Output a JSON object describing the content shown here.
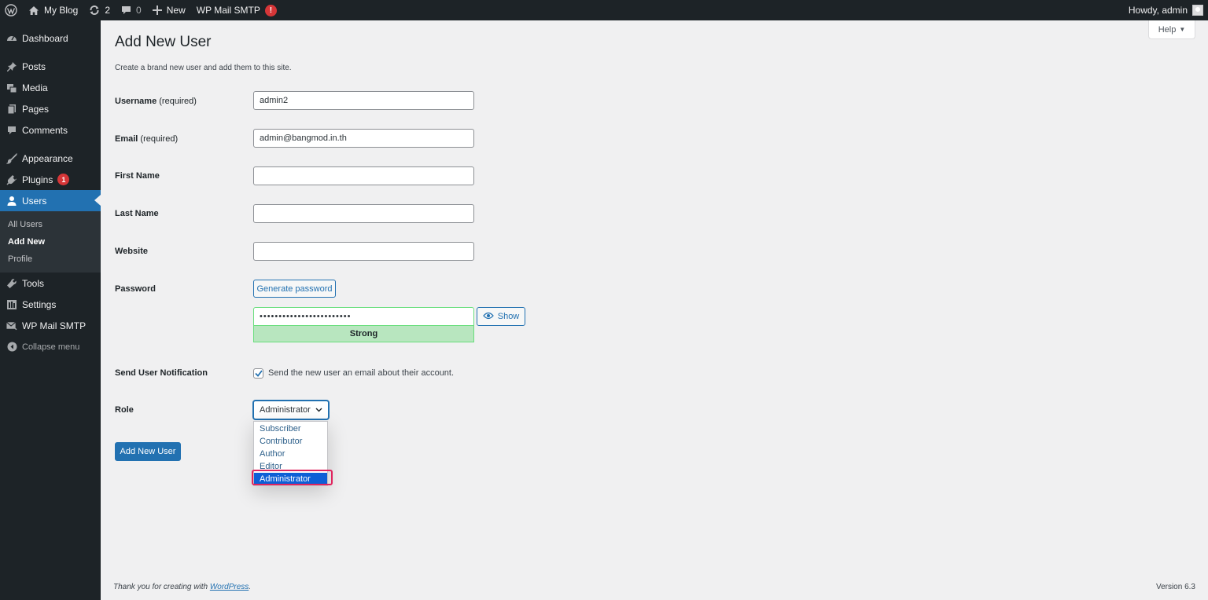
{
  "adminbar": {
    "site_name": "My Blog",
    "updates_count": "2",
    "comments_count": "0",
    "new_label": "New",
    "plugin_label": "WP Mail SMTP",
    "plugin_alert": "!",
    "greeting": "Howdy, admin"
  },
  "sidebar": {
    "items": [
      {
        "label": "Dashboard",
        "icon": "dashboard-icon"
      },
      {
        "label": "Posts",
        "icon": "pin-icon"
      },
      {
        "label": "Media",
        "icon": "media-icon"
      },
      {
        "label": "Pages",
        "icon": "pages-icon"
      },
      {
        "label": "Comments",
        "icon": "comments-icon"
      },
      {
        "label": "Appearance",
        "icon": "brush-icon"
      },
      {
        "label": "Plugins",
        "icon": "plugin-icon",
        "badge": "1"
      },
      {
        "label": "Users",
        "icon": "user-icon"
      },
      {
        "label": "Tools",
        "icon": "wrench-icon"
      },
      {
        "label": "Settings",
        "icon": "settings-icon"
      },
      {
        "label": "WP Mail SMTP",
        "icon": "mail-icon"
      }
    ],
    "submenu": [
      "All Users",
      "Add New",
      "Profile"
    ],
    "collapse": "Collapse menu"
  },
  "main": {
    "help": "Help",
    "title": "Add New User",
    "description": "Create a brand new user and add them to this site.",
    "form": {
      "username_label": "Username",
      "username_req": "(required)",
      "username_value": "admin2",
      "email_label": "Email",
      "email_req": "(required)",
      "email_value": "admin@bangmod.in.th",
      "first_name_label": "First Name",
      "first_name_value": "",
      "last_name_label": "Last Name",
      "last_name_value": "",
      "website_label": "Website",
      "website_value": "",
      "password_label": "Password",
      "generate_password": "Generate password",
      "password_value": "••••••••••••••••••••••••",
      "show_label": "Show",
      "strength": "Strong",
      "notification_label": "Send User Notification",
      "notification_text": "Send the new user an email about their account.",
      "role_label": "Role",
      "role_value": "Administrator",
      "role_options": [
        "Subscriber",
        "Contributor",
        "Author",
        "Editor",
        "Administrator"
      ],
      "submit": "Add New User"
    }
  },
  "footer": {
    "thanks_prefix": "Thank you for creating with ",
    "thanks_link": "WordPress",
    "thanks_suffix": ".",
    "version": "Version 6.3"
  },
  "colors": {
    "admin_bar": "#1d2327",
    "accent": "#2271b1",
    "badge": "#d63638",
    "strength_bg": "#b8e6bf",
    "highlight": "#e0245e"
  }
}
